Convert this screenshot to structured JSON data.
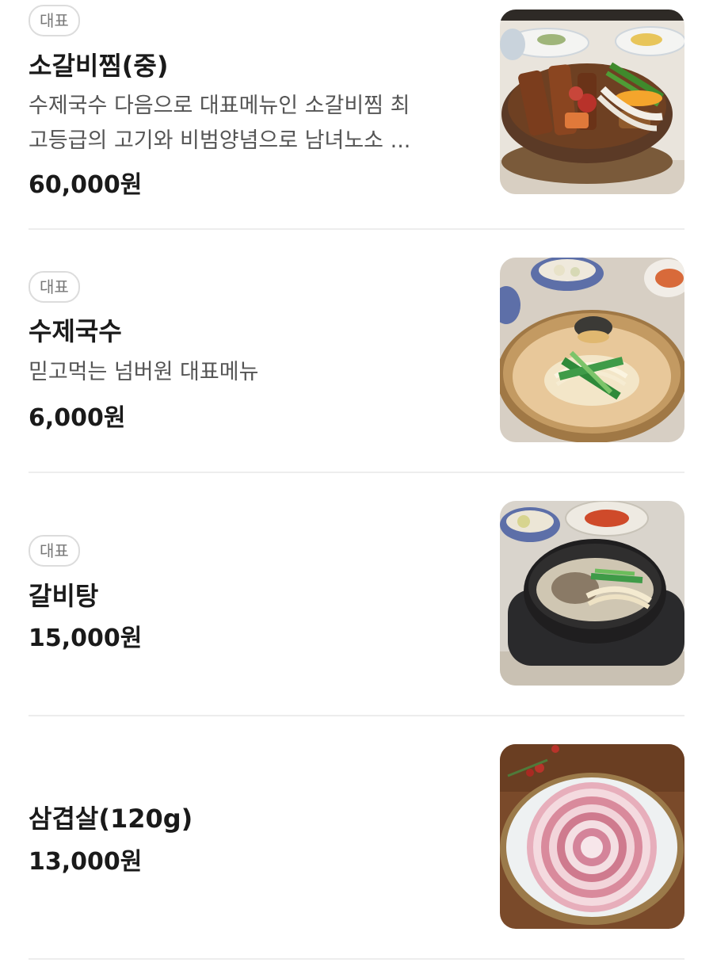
{
  "menu": {
    "items": [
      {
        "badge": "대표",
        "name": "소갈비찜(중)",
        "desc_line1": "수제국수 다음으로 대표메뉴인 소갈비찜 최",
        "desc_line2": "고등급의 고기와 비범양념으로 남녀노소 ...",
        "price": "60,000원",
        "image_icon": "braised-short-ribs-photo"
      },
      {
        "badge": "대표",
        "name": "수제국수",
        "desc_line1": "믿고먹는 넘버원 대표메뉴",
        "price": "6,000원",
        "image_icon": "handmade-noodles-photo"
      },
      {
        "badge": "대표",
        "name": "갈비탕",
        "price": "15,000원",
        "image_icon": "galbitang-photo"
      },
      {
        "name": "삼겹살(120g)",
        "price": "13,000원",
        "image_icon": "pork-belly-photo"
      }
    ]
  },
  "colors": {
    "text_primary": "#1a1a1a",
    "text_secondary": "#555555",
    "badge_border": "#dcdcdc",
    "divider": "#ededed"
  }
}
